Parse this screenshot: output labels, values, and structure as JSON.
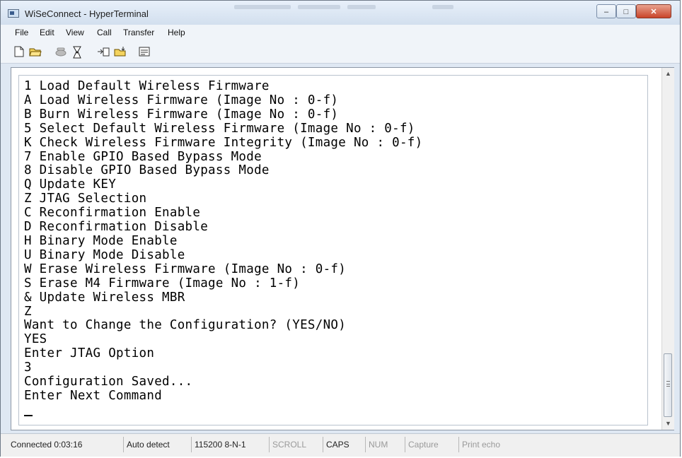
{
  "window": {
    "title": "WiSeConnect - HyperTerminal",
    "minimize_glyph": "–",
    "maximize_glyph": "□",
    "close_glyph": "✕"
  },
  "menu": {
    "file": "File",
    "edit": "Edit",
    "view": "View",
    "call": "Call",
    "transfer": "Transfer",
    "help": "Help"
  },
  "toolbar": {
    "icons": [
      "new-file-icon",
      "open-folder-icon",
      "phone-dial-icon",
      "disconnect-icon",
      "send-file-icon",
      "receive-file-icon",
      "properties-icon"
    ]
  },
  "terminal": {
    "lines": [
      "1 Load Default Wireless Firmware",
      "A Load Wireless Firmware (Image No : 0-f)",
      "B Burn Wireless Firmware (Image No : 0-f)",
      "5 Select Default Wireless Firmware (Image No : 0-f)",
      "K Check Wireless Firmware Integrity (Image No : 0-f)",
      "7 Enable GPIO Based Bypass Mode",
      "8 Disable GPIO Based Bypass Mode",
      "Q Update KEY",
      "Z JTAG Selection",
      "C Reconfirmation Enable",
      "D Reconfirmation Disable",
      "H Binary Mode Enable",
      "U Binary Mode Disable",
      "W Erase Wireless Firmware (Image No : 0-f)",
      "S Erase M4 Firmware (Image No : 1-f)",
      "& Update Wireless MBR",
      "Z",
      "Want to Change the Configuration? (YES/NO)",
      "YES",
      "Enter JTAG Option",
      "3",
      "Configuration Saved...",
      "Enter Next Command"
    ]
  },
  "scrollbar": {
    "up_glyph": "▲",
    "down_glyph": "▼"
  },
  "status": {
    "connected": "Connected 0:03:16",
    "detect": "Auto detect",
    "settings": "115200 8-N-1",
    "scroll": "SCROLL",
    "caps": "CAPS",
    "num": "NUM",
    "capture": "Capture",
    "print_echo": "Print echo"
  }
}
